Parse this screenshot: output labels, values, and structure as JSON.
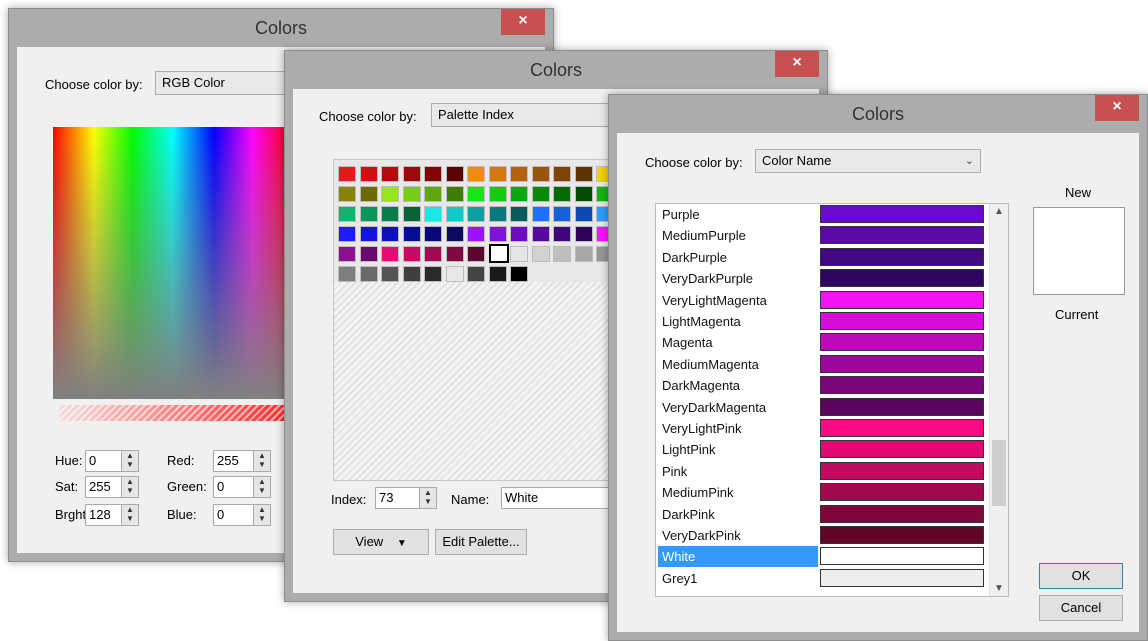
{
  "win1": {
    "title": "Colors",
    "close": "×",
    "choose_label": "Choose color by:",
    "mode": "RGB Color",
    "hue_label": "Hue:",
    "hue": "0",
    "sat_label": "Sat:",
    "sat": "255",
    "brght_label": "Brght:",
    "brght": "128",
    "red_label": "Red:",
    "red": "255",
    "green_label": "Green:",
    "green": "0",
    "blue_label": "Blue:",
    "blue": "0"
  },
  "win2": {
    "title": "Colors",
    "close": "×",
    "choose_label": "Choose color by:",
    "mode": "Palette Index",
    "index_label": "Index:",
    "index": "73",
    "name_label": "Name:",
    "name": "White",
    "view_button": "View",
    "edit_button": "Edit Palette...",
    "palette_rows": [
      [
        "#e31b1b",
        "#d01010",
        "#b00e0e",
        "#9c0a0a",
        "#800606",
        "#5c0404",
        "#f08a12",
        "#d4780c",
        "#b4620c",
        "#9a540a",
        "#7e4406",
        "#5e3404",
        "#f2d400"
      ],
      [
        "#868400",
        "#6c6a00",
        "#96e61e",
        "#78cc14",
        "#5ea80e",
        "#3f7c08",
        "#12e812",
        "#0ecc0e",
        "#0aa80a",
        "#088a08",
        "#066a06",
        "#044c04",
        "#10b410"
      ],
      [
        "#11b46c",
        "#0c9456",
        "#0a7c48",
        "#086238",
        "#19e6e6",
        "#12c8c8",
        "#0ea0a0",
        "#0a7a7a",
        "#085c5c",
        "#1f72ff",
        "#1660dc",
        "#0e48b4",
        "#2c9cff"
      ],
      [
        "#1c1cff",
        "#1414dc",
        "#0e0ebc",
        "#0a0a98",
        "#08087a",
        "#0a0a5e",
        "#a012ff",
        "#8410e0",
        "#6c0cc0",
        "#54089c",
        "#40067c",
        "#2e045a",
        "#ff10ff"
      ],
      [
        "#8c1090",
        "#6c0a70",
        "#e60a78",
        "#c80a64",
        "#a40a54",
        "#820844",
        "#5e0630",
        "#ffffff",
        "#e6e6e6",
        "#d2d2d2",
        "#bebebe",
        "#a8a8a8",
        "#969696"
      ],
      [
        "#7e7e7e",
        "#6a6a6a",
        "#545454",
        "#3e3e3e",
        "#2a2a2a",
        "#e8e8e8",
        "#444444",
        "#1a1a1a",
        "#000000"
      ]
    ]
  },
  "win3": {
    "title": "Colors",
    "close": "×",
    "choose_label": "Choose color by:",
    "mode": "Color Name",
    "new_label": "New",
    "current_label": "Current",
    "ok_button": "OK",
    "cancel_button": "Cancel",
    "colors": [
      {
        "name": "Purple",
        "color": "#6a0ccd"
      },
      {
        "name": "MediumPurple",
        "color": "#5a0aa8"
      },
      {
        "name": "DarkPurple",
        "color": "#440882"
      },
      {
        "name": "VeryDarkPurple",
        "color": "#2e0660"
      },
      {
        "name": "VeryLightMagenta",
        "color": "#f214f2"
      },
      {
        "name": "LightMagenta",
        "color": "#d80cd8"
      },
      {
        "name": "Magenta",
        "color": "#bb0abb"
      },
      {
        "name": "MediumMagenta",
        "color": "#9c089c"
      },
      {
        "name": "DarkMagenta",
        "color": "#7c067c"
      },
      {
        "name": "VeryDarkMagenta",
        "color": "#5c045c"
      },
      {
        "name": "VeryLightPink",
        "color": "#fc0a86"
      },
      {
        "name": "LightPink",
        "color": "#e00a72"
      },
      {
        "name": "Pink",
        "color": "#c20860"
      },
      {
        "name": "MediumPink",
        "color": "#a2084e"
      },
      {
        "name": "DarkPink",
        "color": "#80063c"
      },
      {
        "name": "VeryDarkPink",
        "color": "#60042a"
      },
      {
        "name": "White",
        "color": "#ffffff",
        "selected": true
      },
      {
        "name": "Grey1",
        "color": "#eeeeee"
      }
    ]
  }
}
